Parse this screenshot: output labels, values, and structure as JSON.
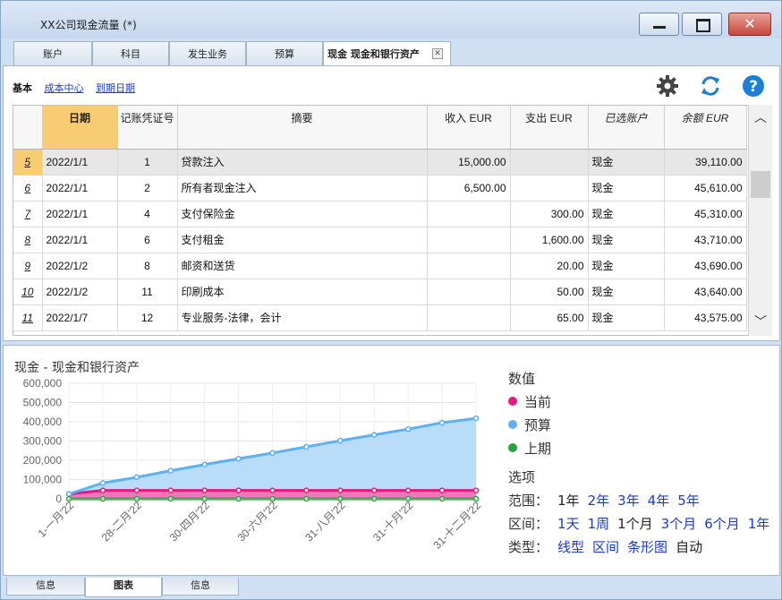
{
  "window": {
    "title": "XX公司现金流量 (*)"
  },
  "tabs": [
    {
      "label": "账户"
    },
    {
      "label": "科目"
    },
    {
      "label": "发生业务"
    },
    {
      "label": "预算"
    },
    {
      "label": "现金 现金和银行资产"
    }
  ],
  "subnav": {
    "base": "基本",
    "cost_center": "成本中心",
    "due_date": "到期日期"
  },
  "toolbar": {
    "settings_icon": "gear-icon",
    "refresh_icon": "refresh-icon",
    "help_icon": "help-icon"
  },
  "table": {
    "headers": [
      "",
      "日期",
      "记账凭证号",
      "摘要",
      "收入 EUR",
      "支出 EUR",
      "已选账户",
      "余额 EUR"
    ],
    "rows": [
      {
        "row": "5",
        "date": "2022/1/1",
        "doc": "1",
        "desc": "贷款注入",
        "income": "15,000.00",
        "expense": "",
        "account": "现金",
        "balance": "39,110.00"
      },
      {
        "row": "6",
        "date": "2022/1/1",
        "doc": "2",
        "desc": "所有者现金注入",
        "income": "6,500.00",
        "expense": "",
        "account": "现金",
        "balance": "45,610.00"
      },
      {
        "row": "7",
        "date": "2022/1/1",
        "doc": "4",
        "desc": "支付保险金",
        "income": "",
        "expense": "300.00",
        "account": "现金",
        "balance": "45,310.00"
      },
      {
        "row": "8",
        "date": "2022/1/1",
        "doc": "6",
        "desc": "支付租金",
        "income": "",
        "expense": "1,600.00",
        "account": "现金",
        "balance": "43,710.00"
      },
      {
        "row": "9",
        "date": "2022/1/2",
        "doc": "8",
        "desc": "邮资和送货",
        "income": "",
        "expense": "20.00",
        "account": "现金",
        "balance": "43,690.00"
      },
      {
        "row": "10",
        "date": "2022/1/2",
        "doc": "11",
        "desc": "印刷成本",
        "income": "",
        "expense": "50.00",
        "account": "现金",
        "balance": "43,640.00"
      },
      {
        "row": "11",
        "date": "2022/1/7",
        "doc": "12",
        "desc": "专业服务-法律，会计",
        "income": "",
        "expense": "65.00",
        "account": "现金",
        "balance": "43,575.00"
      }
    ]
  },
  "chart_title": "现金 - 现金和银行资产",
  "chart_data": {
    "type": "area",
    "title": "现金 - 现金和银行资产",
    "x": [
      "1-一月'22",
      "28-一月'22",
      "28-二月'22",
      "31-三月'22",
      "30-四月'22",
      "31-五月'22",
      "30-六月'22",
      "31-七月'22",
      "31-八月'22",
      "30-九月'22",
      "31-十月'22",
      "30-十一月'22",
      "31-十二月'22"
    ],
    "tick_labels": [
      "1-一月'22",
      "28-二月'22",
      "30-四月'22",
      "30-六月'22",
      "31-八月'22",
      "31-十月'22",
      "31-十二月'22"
    ],
    "ylim": [
      0,
      600000
    ],
    "yticks": [
      "0",
      "100,000",
      "200,000",
      "300,000",
      "400,000",
      "500,000",
      "600,000"
    ],
    "series": [
      {
        "name": "当前",
        "color": "#e8177f",
        "values": [
          25000,
          43575,
          43575,
          43575,
          43575,
          43575,
          43575,
          43575,
          43575,
          43575,
          43575,
          43575,
          43575
        ]
      },
      {
        "name": "预算",
        "color": "#5db0f1",
        "values": [
          25000,
          82000,
          112000,
          146000,
          178000,
          208000,
          238000,
          270000,
          302000,
          332000,
          362000,
          395000,
          418000
        ]
      },
      {
        "name": "上期",
        "color": "#22a33c",
        "values": [
          0,
          0,
          0,
          0,
          0,
          0,
          0,
          0,
          0,
          0,
          0,
          0,
          0
        ]
      }
    ],
    "grid": true
  },
  "legend": {
    "heading": "数值",
    "items": [
      {
        "label": "当前",
        "color": "#e8177f"
      },
      {
        "label": "预算",
        "color": "#5db0f1"
      },
      {
        "label": "上期",
        "color": "#22a33c"
      }
    ]
  },
  "options": {
    "heading": "选项",
    "range_label": "范围：",
    "range": [
      {
        "t": "1年",
        "link": false
      },
      {
        "t": "2年",
        "link": true
      },
      {
        "t": "3年",
        "link": true
      },
      {
        "t": "4年",
        "link": true
      },
      {
        "t": "5年",
        "link": true
      }
    ],
    "interval_label": "区间：",
    "interval": [
      {
        "t": "1天",
        "link": true
      },
      {
        "t": "1周",
        "link": true
      },
      {
        "t": "1个月",
        "link": false
      },
      {
        "t": "3个月",
        "link": true
      },
      {
        "t": "6个月",
        "link": true
      },
      {
        "t": "1年",
        "link": true
      }
    ],
    "type_label": "类型：",
    "type": [
      {
        "t": "线型",
        "link": true
      },
      {
        "t": "区间",
        "link": true
      },
      {
        "t": "条形图",
        "link": true
      },
      {
        "t": "自动",
        "link": false
      }
    ]
  },
  "bottom_tabs": [
    {
      "label": "信息"
    },
    {
      "label": "图表"
    },
    {
      "label": "信息"
    }
  ]
}
